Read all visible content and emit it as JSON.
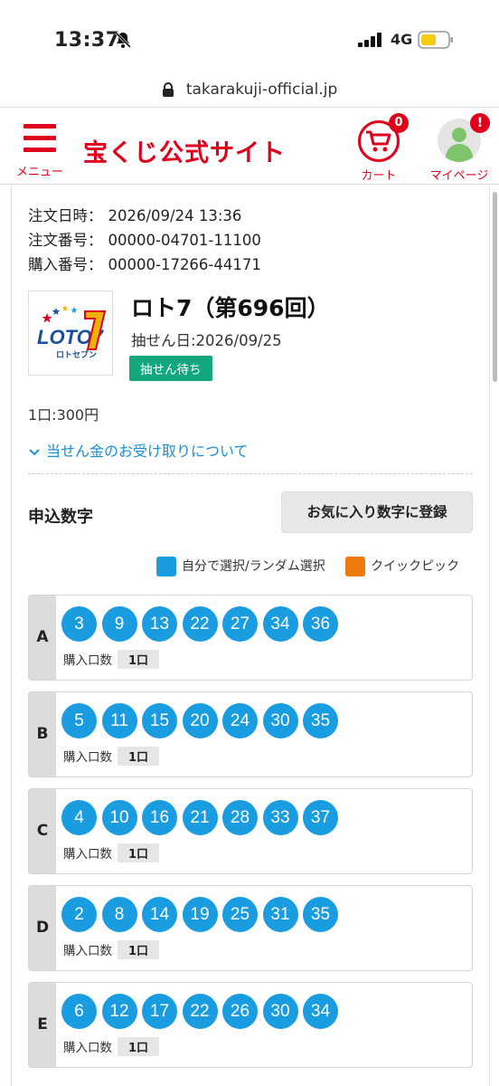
{
  "status_bar": {
    "time": "13:37",
    "network": "4G",
    "icons": [
      "bell-slash-icon",
      "signal-icon",
      "battery-icon"
    ],
    "battery_color": "#f5cc13"
  },
  "browser": {
    "url": "takarakuji-official.jp"
  },
  "header": {
    "menu_label": "メニュー",
    "site_title": "宝くじ公式サイト",
    "cart_label": "カート",
    "cart_count": "0",
    "mypage_label": "マイページ",
    "mypage_badge": "!",
    "brand_color": "#e0001b"
  },
  "order": {
    "date_label": "注文日時：",
    "date_value": "2026/09/24 13:36",
    "order_no_label": "注文番号：",
    "order_no_value": "00000-04701-11100",
    "purchase_no_label": "購入番号：",
    "purchase_no_value": "00000-17266-44171"
  },
  "product": {
    "logo_text": "LOTO7",
    "logo_sub": "ロトセブン",
    "title": "ロト7（第696回）",
    "draw_date": "抽せん日:2026/09/25",
    "status": "抽せん待ち",
    "unit_price": "1口:300円",
    "prize_link": "当せん金のお受け取りについて"
  },
  "numbers_section": {
    "title": "申込数字",
    "fav_button": "お気に入り数字に登録",
    "legend": [
      {
        "label": "自分で選択/ランダム選択",
        "color": "#1a9ce0"
      },
      {
        "label": "クイックピック",
        "color": "#ec7a0c"
      }
    ],
    "qty_label": "購入口数",
    "lines": [
      {
        "letter": "A",
        "numbers": [
          "3",
          "9",
          "13",
          "22",
          "27",
          "34",
          "36"
        ],
        "qty": "1口"
      },
      {
        "letter": "B",
        "numbers": [
          "5",
          "11",
          "15",
          "20",
          "24",
          "30",
          "35"
        ],
        "qty": "1口"
      },
      {
        "letter": "C",
        "numbers": [
          "4",
          "10",
          "16",
          "21",
          "28",
          "33",
          "37"
        ],
        "qty": "1口"
      },
      {
        "letter": "D",
        "numbers": [
          "2",
          "8",
          "14",
          "19",
          "25",
          "31",
          "35"
        ],
        "qty": "1口"
      },
      {
        "letter": "E",
        "numbers": [
          "6",
          "12",
          "17",
          "22",
          "26",
          "30",
          "34"
        ],
        "qty": "1口"
      }
    ]
  }
}
